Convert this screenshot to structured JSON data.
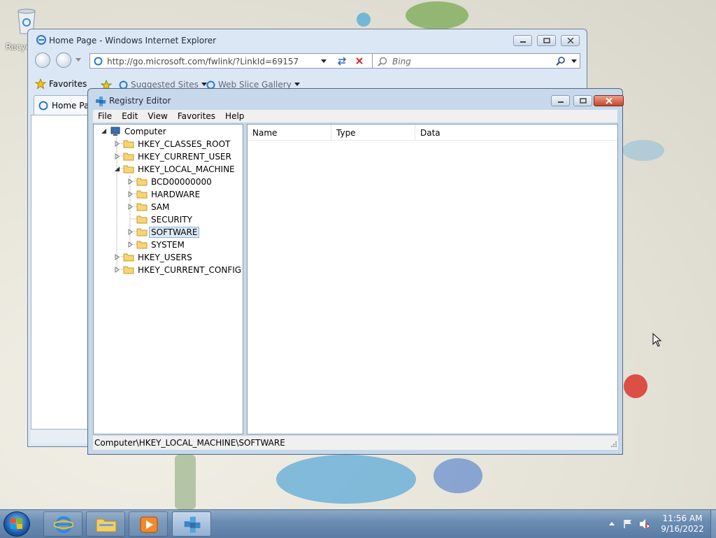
{
  "desktop": {
    "recycle_label": "Recyc"
  },
  "ie": {
    "title": "Home Page - Windows Internet Explorer",
    "address_url": "http://go.microsoft.com/fwlink/?LinkId=69157",
    "search_placeholder": "Bing",
    "favorites_label": "Favorites",
    "suggested_sites": "Suggested Sites",
    "web_slice_gallery": "Web Slice Gallery",
    "tab_label": "Home Pa"
  },
  "regedit": {
    "title": "Registry Editor",
    "menu": [
      "File",
      "Edit",
      "View",
      "Favorites",
      "Help"
    ],
    "tree": {
      "root": "Computer",
      "hives": [
        "HKEY_CLASSES_ROOT",
        "HKEY_CURRENT_USER",
        "HKEY_LOCAL_MACHINE"
      ],
      "hklm_children": [
        "BCD00000000",
        "HARDWARE",
        "SAM",
        "SECURITY",
        "SOFTWARE",
        "SYSTEM"
      ],
      "more_hives": [
        "HKEY_USERS",
        "HKEY_CURRENT_CONFIG"
      ],
      "selected": "SOFTWARE"
    },
    "columns": [
      "Name",
      "Type",
      "Data"
    ],
    "status_path": "Computer\\HKEY_LOCAL_MACHINE\\SOFTWARE"
  },
  "taskbar": {
    "time": "11:56 AM",
    "date": "9/16/2022",
    "buttons": [
      "internet-explorer",
      "windows-explorer",
      "media-player",
      "registry-editor"
    ]
  },
  "colors": {
    "taskbar": "#6c8db3",
    "window_frame": "#c6d8ea",
    "close_red": "#c7452a",
    "selection": "#dfeaf7"
  }
}
